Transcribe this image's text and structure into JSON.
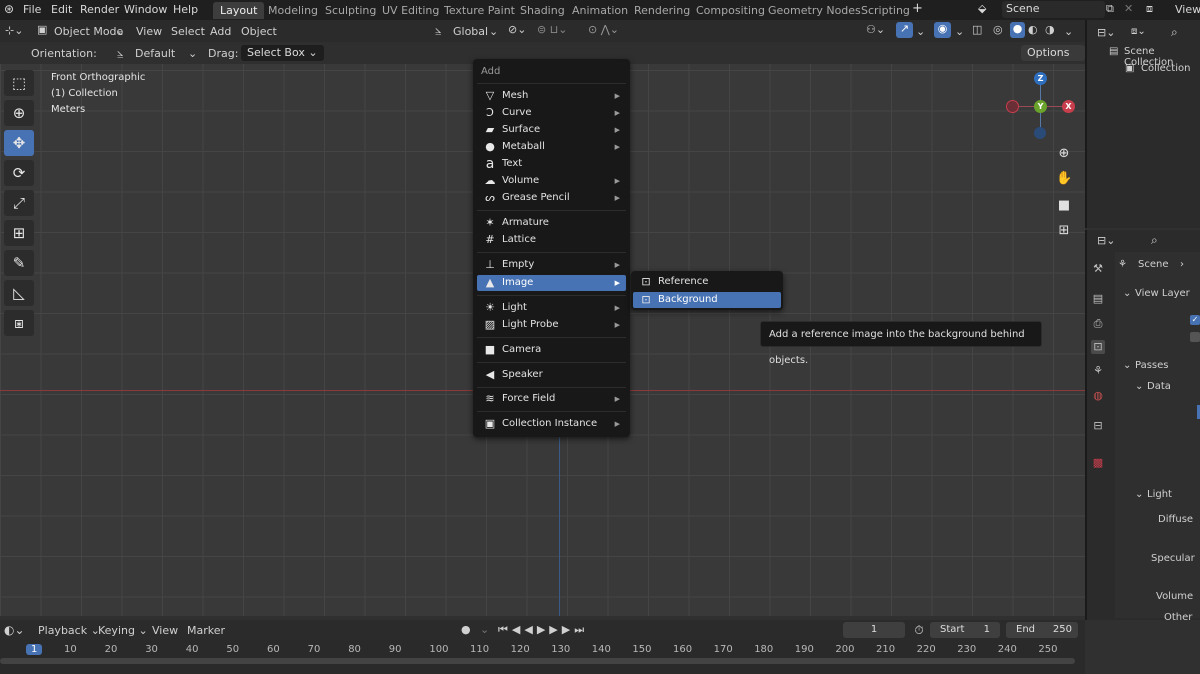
{
  "menubar": {
    "items": [
      "File",
      "Edit",
      "Render",
      "Window",
      "Help"
    ],
    "workspaces": [
      "Layout",
      "Modeling",
      "Sculpting",
      "UV Editing",
      "Texture Paint",
      "Shading",
      "Animation",
      "Rendering",
      "Compositing",
      "Geometry Nodes",
      "Scripting"
    ],
    "active_workspace": "Layout",
    "scene": "Scene",
    "view_layer": "View"
  },
  "header": {
    "mode": "Object Mode",
    "menus": [
      "View",
      "Select",
      "Add",
      "Object"
    ],
    "transform": "Global",
    "options": "Options"
  },
  "toolheader": {
    "orientation_label": "Orientation:",
    "orientation_value": "Default",
    "drag_label": "Drag:",
    "drag_value": "Select Box"
  },
  "overlay": {
    "view": "Front Orthographic",
    "collection": "(1) Collection",
    "units": "Meters"
  },
  "add_menu": {
    "title": "Add",
    "items": [
      {
        "label": "Mesh",
        "icon": "mesh-icon",
        "glyph": "▽",
        "sub": "▶"
      },
      {
        "label": "Curve",
        "icon": "curve-icon",
        "glyph": "Ↄ",
        "sub": "▶"
      },
      {
        "label": "Surface",
        "icon": "surface-icon",
        "glyph": "▰",
        "sub": "▶"
      },
      {
        "label": "Metaball",
        "icon": "metaball-icon",
        "glyph": "●",
        "sub": "▶"
      },
      {
        "label": "Text",
        "icon": "text-icon",
        "glyph": "a",
        "sub": ""
      },
      {
        "label": "Volume",
        "icon": "volume-icon",
        "glyph": "☁",
        "sub": "▶"
      },
      {
        "label": "Grease Pencil",
        "icon": "grease-pencil-icon",
        "glyph": "ᔕ",
        "sub": "▶"
      },
      {
        "label": "Armature",
        "icon": "armature-icon",
        "glyph": "✶",
        "sub": ""
      },
      {
        "label": "Lattice",
        "icon": "lattice-icon",
        "glyph": "#",
        "sub": ""
      },
      {
        "label": "Empty",
        "icon": "empty-icon",
        "glyph": "⊥",
        "sub": "▶"
      },
      {
        "label": "Image",
        "icon": "image-icon",
        "glyph": "▲",
        "sub": "▶"
      },
      {
        "label": "Light",
        "icon": "light-icon",
        "glyph": "☀",
        "sub": "▶"
      },
      {
        "label": "Light Probe",
        "icon": "light-probe-icon",
        "glyph": "▨",
        "sub": "▶"
      },
      {
        "label": "Camera",
        "icon": "camera-icon",
        "glyph": "■",
        "sub": ""
      },
      {
        "label": "Speaker",
        "icon": "speaker-icon",
        "glyph": "◀",
        "sub": ""
      },
      {
        "label": "Force Field",
        "icon": "force-field-icon",
        "glyph": "≋",
        "sub": "▶"
      },
      {
        "label": "Collection Instance",
        "icon": "collection-instance-icon",
        "glyph": "▣",
        "sub": "▶"
      }
    ]
  },
  "image_submenu": {
    "items": [
      {
        "label": "Reference",
        "icon": "reference-icon"
      },
      {
        "label": "Background",
        "icon": "background-icon"
      }
    ]
  },
  "tooltip": "Add a reference image into the background behind objects.",
  "gizmo": {
    "z": "Z",
    "y": "Y",
    "x": "X"
  },
  "outliner": {
    "scene_collection": "Scene Collection",
    "collection": "Collection"
  },
  "properties": {
    "scene": "Scene",
    "view_layer": "View Layer",
    "passes": "Passes",
    "data": "Data",
    "light": "Light",
    "diffuse": "Diffuse",
    "specular": "Specular",
    "volume": "Volume",
    "other": "Other"
  },
  "timeline": {
    "menus": [
      "Playback",
      "Keying",
      "View",
      "Marker"
    ],
    "current_frame": "1",
    "start_label": "Start",
    "start": "1",
    "end_label": "End",
    "end": "250",
    "ticks": [
      "1",
      "10",
      "20",
      "30",
      "40",
      "50",
      "60",
      "70",
      "80",
      "90",
      "100",
      "110",
      "120",
      "130",
      "140",
      "150",
      "160",
      "170",
      "180",
      "190",
      "200",
      "210",
      "220",
      "230",
      "240",
      "250"
    ]
  }
}
